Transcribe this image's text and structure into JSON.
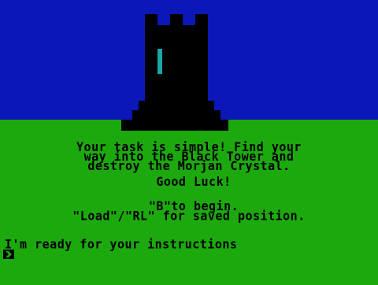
{
  "colors": {
    "sky": "#0c17b8",
    "ground": "#1ca90e",
    "tower": "#000000",
    "window": "#1aa6a6",
    "text": "#000000"
  },
  "intro": {
    "line1": "Your task is simple! Find your",
    "line2": "way into the Black Tower and",
    "line3": "destroy the Morjan Crystal.",
    "line4": "Good Luck!"
  },
  "instructions": {
    "begin": "\"B\"to begin.",
    "load": "\"Load\"/\"RL\" for saved position."
  },
  "prompt": {
    "text": "I'm ready for your instructions",
    "cursor_icon": "cursor-arrow-icon"
  }
}
